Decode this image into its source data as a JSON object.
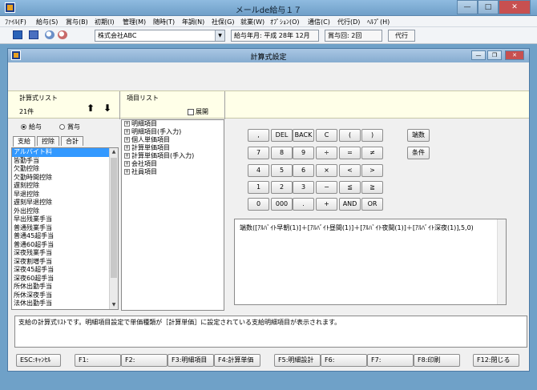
{
  "window": {
    "title": "メールde給与１７",
    "min": "—",
    "max": "□",
    "close": "✕"
  },
  "menu": [
    "ﾌｧｲﾙ(F)",
    "給与(S)",
    "賞与(B)",
    "初期(I)",
    "管理(M)",
    "随時(T)",
    "年調(N)",
    "社保(G)",
    "就業(W)",
    "ｵﾌﾟｼｮﾝ(O)",
    "通信(C)",
    "代行(D)",
    "ﾍﾙﾌﾟ(H)"
  ],
  "toolbar": {
    "company": "株式会社ABC",
    "pay_period": "給与年月: 平成 28年 12月",
    "bonus_count": "賞与回: 2回",
    "proxy_button": "代行"
  },
  "dialog": {
    "title": "計算式設定",
    "formula_list_label": "計算式リスト",
    "formula_count": "21件",
    "item_list_label": "項目リスト",
    "expand_label": "展開",
    "radio_salary": "給与",
    "radio_bonus": "賞与",
    "tabs": [
      "支給",
      "控除",
      "合計"
    ],
    "list_items": [
      "アルバイト料",
      "皆勤手当",
      "欠勤控除",
      "欠勤時間控除",
      "遅刻控除",
      "早退控除",
      "遅刻早退控除",
      "外出控除",
      "早出残業手当",
      "普通残業手当",
      "普通45超手当",
      "普通60超手当",
      "深夜残業手当",
      "深夜割増手当",
      "深夜45超手当",
      "深夜60超手当",
      "所休出勤手当",
      "所休深夜手当",
      "法休出勤手当"
    ],
    "tree_items": [
      "明細項目",
      "明細項目(手入力)",
      "個人単価項目",
      "計算単価項目",
      "計算単価項目(手入力)",
      "会社項目",
      "社員項目"
    ],
    "calc_rows": [
      [
        ",",
        "DEL",
        "BACK",
        "C",
        "(",
        ")"
      ],
      [
        "7",
        "8",
        "9",
        "÷",
        "=",
        "≠"
      ],
      [
        "4",
        "5",
        "6",
        "×",
        "<",
        ">"
      ],
      [
        "1",
        "2",
        "3",
        "−",
        "≦",
        "≧"
      ],
      [
        "0",
        "000",
        ".",
        "+",
        "AND",
        "OR"
      ]
    ],
    "side_buttons": [
      "端数",
      "条件"
    ],
    "formula": "端数([ｱﾙﾊﾞｲﾄ早朝(1)]＋[ｱﾙﾊﾞｲﾄ昼間(1)]＋[ｱﾙﾊﾞｲﾄ夜間(1)]＋[ｱﾙﾊﾞｲﾄ深夜(1)],5,0)",
    "description": "支給の計算式ﾘｽﾄです。明細項目設定で単価種類が［計算単価］に設定されている支給明細項目が表示されます。",
    "fkeys": [
      "ESC:ｷｬﾝｾﾙ",
      "F1:",
      "F2:",
      "F3:明細項目",
      "F4:計算単価",
      "F5:明細設計",
      "F6:",
      "F7:",
      "F8:印刷",
      "F12:閉じる"
    ]
  }
}
